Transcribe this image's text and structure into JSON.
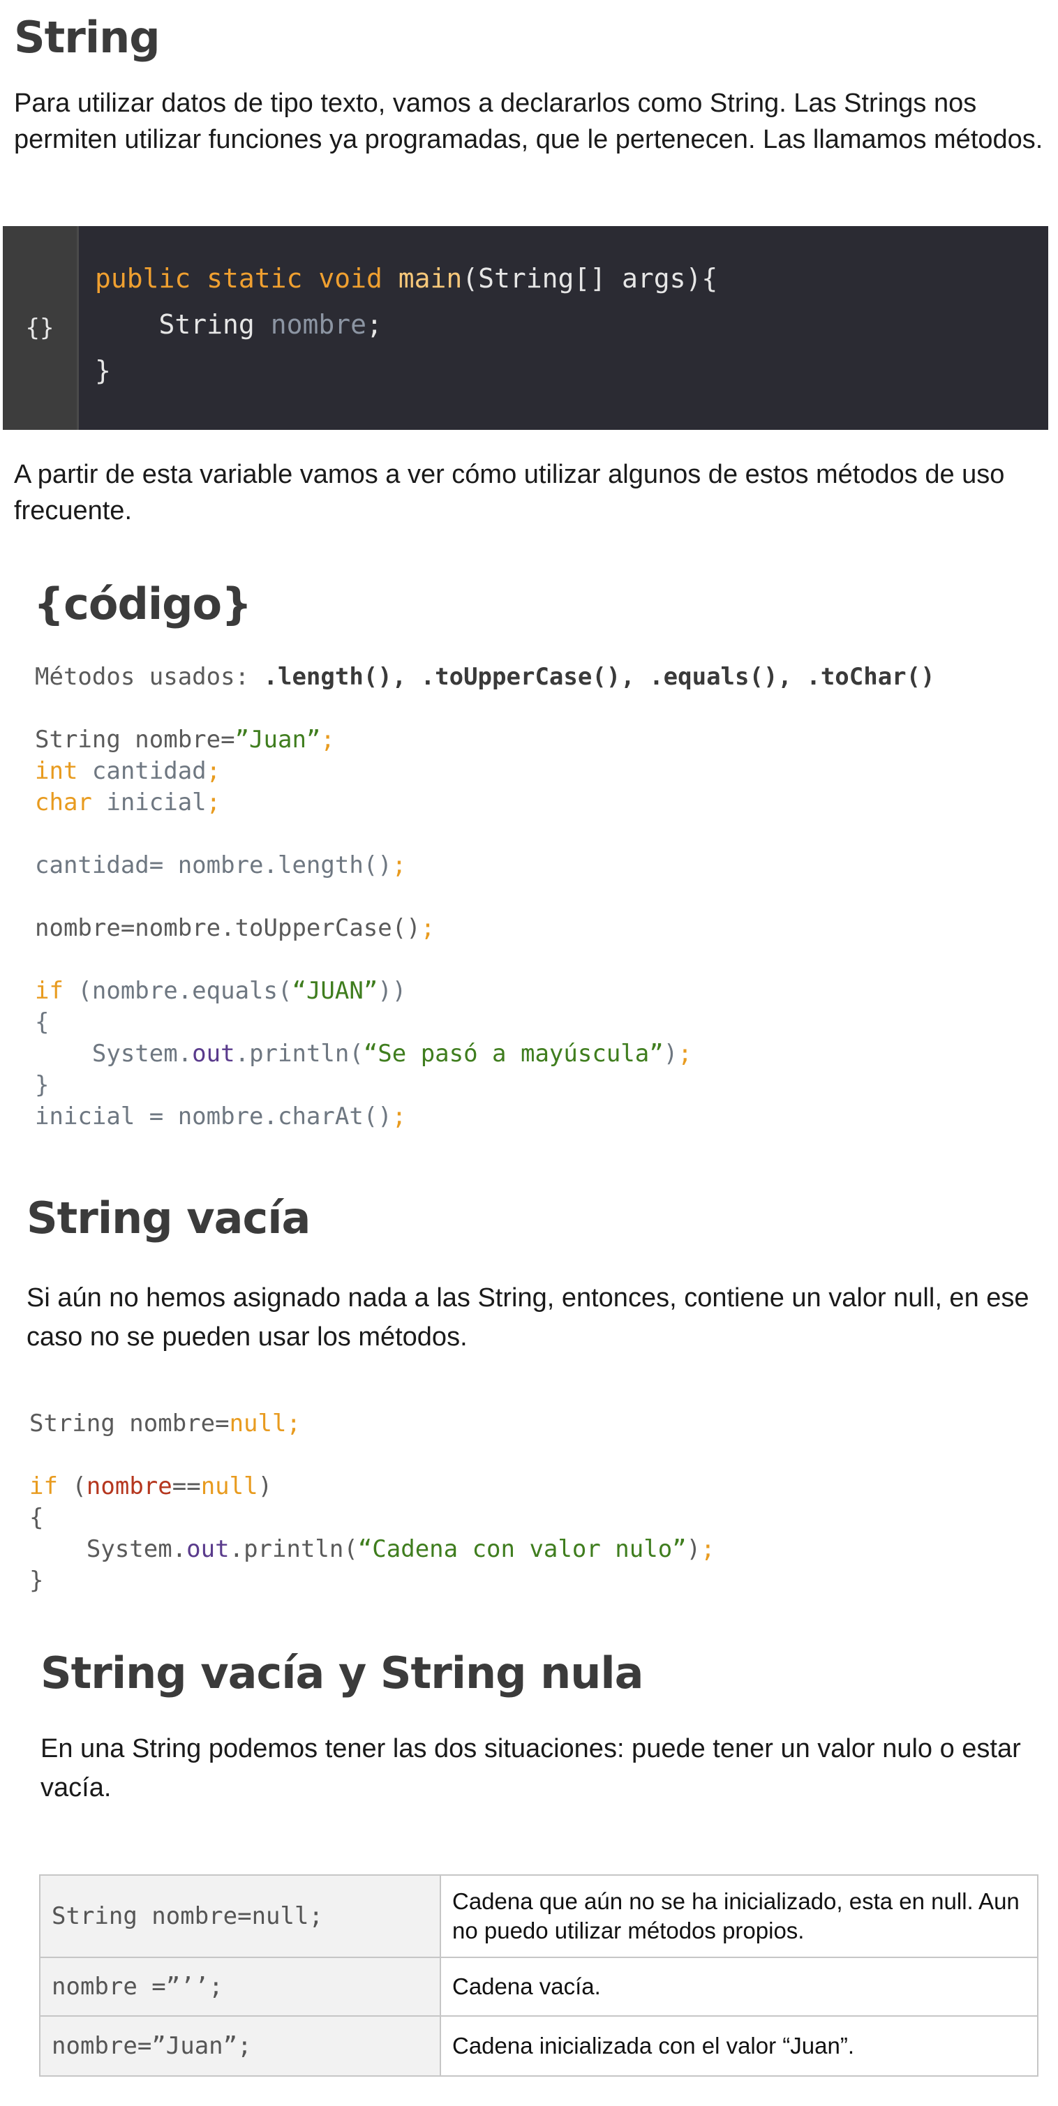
{
  "section1": {
    "title": "String",
    "paragraph": "Para utilizar datos de tipo texto, vamos a declararlos como String. Las Strings nos permiten utilizar funciones ya programadas, que le pertenecen. Las llamamos métodos."
  },
  "code_block_1": {
    "gutter_icon": "{}",
    "lines": {
      "l1_k1": "public",
      "l1_k2": "static",
      "l1_k3": "void",
      "l1_fn": "main",
      "l1_rest": "(String[] args){",
      "l2_type": "String",
      "l2_var": "nombre",
      "l2_semi": ";",
      "l3": "}"
    }
  },
  "section1b": {
    "paragraph": "A partir de esta variable vamos a ver cómo utilizar algunos de estos métodos de uso frecuente."
  },
  "codigo": {
    "title": "{código}",
    "methods_label": "Métodos usados: ",
    "methods_list": ".length(), .toUpperCase(), .equals(), .toChar()",
    "l1_a": "String nombre=",
    "l1_str": "”Juan”",
    "l1_semi": ";",
    "l2_kw": "int",
    "l2_var": " cantidad",
    "l2_semi": ";",
    "l3_kw": "char",
    "l3_var": " inicial",
    "l3_semi": ";",
    "l4_var": "cantidad= nombre.length()",
    "l4_semi": ";",
    "l5_plain": "nombre=nombre.toUpperCase()",
    "l5_semi": ";",
    "l6_kw": "if",
    "l6_a": " (nombre.equals(",
    "l6_str": "“JUAN”",
    "l6_b": "))",
    "l7": "{",
    "l8_a": "    System.",
    "l8_field": "out",
    "l8_b": ".println(",
    "l8_str": "“Se pasó a mayúscula”",
    "l8_c": ")",
    "l8_semi": ";",
    "l9": "}",
    "l10_var": "inicial = nombre.charAt()",
    "l10_semi": ";"
  },
  "section2": {
    "title": "String vacía",
    "paragraph": "Si aún no hemos asignado nada a las String, entonces, contiene un valor null, en ese caso no se pueden usar los métodos.",
    "l1_a": "String nombre=",
    "l1_kw": "null",
    "l1_semi": ";",
    "l2_kw": "if",
    "l2_a": " (",
    "l2_red": "nombre",
    "l2_b": "==",
    "l2_kw2": "null",
    "l2_c": ")",
    "l3": "{",
    "l4_a": "    System.",
    "l4_field": "out",
    "l4_b": ".println(",
    "l4_str": "“Cadena con valor nulo”",
    "l4_c": ")",
    "l4_semi": ";",
    "l5": "}"
  },
  "section3": {
    "title": "String vacía y String nula",
    "paragraph": "En una String podemos tener las dos situaciones: puede tener un valor nulo o estar vacía.",
    "table": [
      {
        "code": "String nombre=null;",
        "desc": "Cadena que aún no se ha inicializado, esta  en null. Aun no puedo utilizar métodos propios."
      },
      {
        "code": "nombre =”’’;",
        "desc": "Cadena vacía."
      },
      {
        "code": "nombre=”Juan”;",
        "desc": "Cadena inicializada con el valor “Juan”."
      }
    ]
  }
}
